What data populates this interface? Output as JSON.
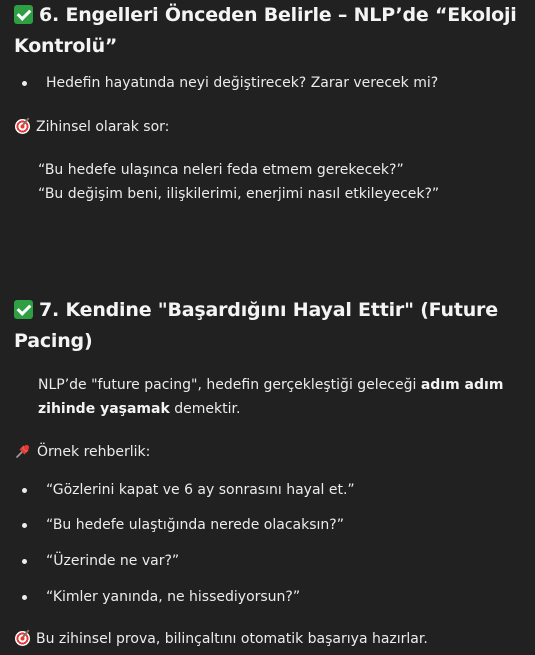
{
  "section6": {
    "title": "6. Engelleri Önceden Belirle – NLP’de “Ekoloji Kontrolü”",
    "bullet1": "Hedefin hayatında neyi değiştirecek? Zarar verecek mi?",
    "prompt_label": "Zihinsel olarak sor:",
    "quote1": "“Bu hedefe ulaşınca neleri feda etmem gerekecek?”",
    "quote2": "“Bu değişim beni, ilişkilerimi, enerjimi nasıl etkileyecek?”"
  },
  "section7": {
    "title": "7. Kendine \"Başardığını Hayal Ettir\" (Future Pacing)",
    "intro_part1": "NLP’de \"future pacing\", hedefin gerçekleştiği geleceği ",
    "intro_bold": "adım adım zihinde yaşamak",
    "intro_part2": " demektir.",
    "guide_label": "Örnek rehberlik:",
    "bullets": [
      "“Gözlerini kapat ve 6 ay sonrasını hayal et.”",
      "“Bu hedefe ulaştığında nerede olacaksın?”",
      "“Üzerinde ne var?”",
      "“Kimler yanında, ne hissediyorsun?”"
    ],
    "closing": "Bu zihinsel prova, bilinçaltını otomatik başarıya hazırlar."
  },
  "icons": {
    "check": "check-mark-icon",
    "target": "direct-hit-icon",
    "pin": "pushpin-icon"
  },
  "colors": {
    "background": "#212121",
    "text": "#ececec",
    "check": "#2ea043"
  }
}
